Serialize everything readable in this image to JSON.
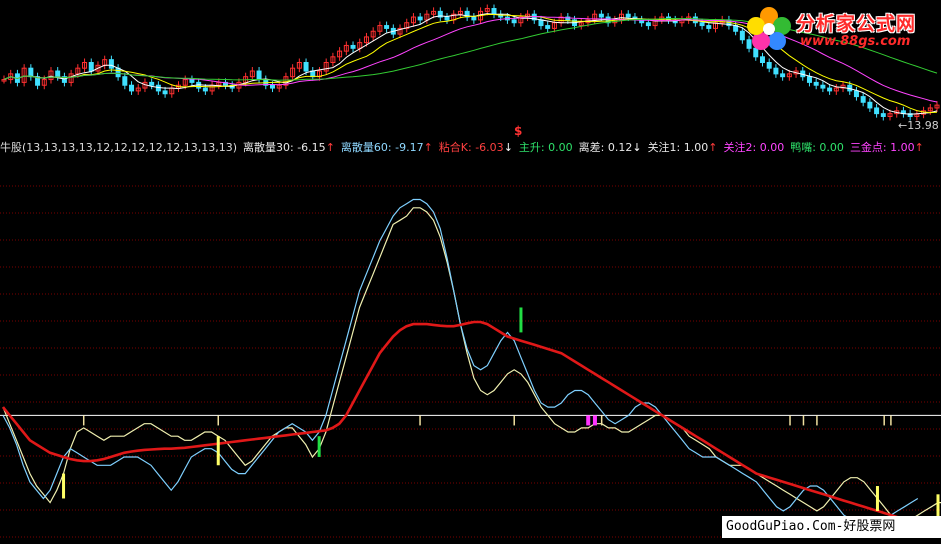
{
  "legend": {
    "items": [
      {
        "label": "牛股(13,13,13,13,12,12,12,12,12,13,13,13)",
        "value": "",
        "arrow": "",
        "color": "#dcdcdc"
      },
      {
        "label": "离散量30:",
        "value": "-6.15",
        "arrow": "↑",
        "color": "#e8e8e8",
        "arrow_color": "#ff3b3b"
      },
      {
        "label": "离散量60:",
        "value": "-9.17",
        "arrow": "↑",
        "color": "#8fd8ff",
        "arrow_color": "#ff3b3b"
      },
      {
        "label": "粘合K:",
        "value": "-6.03",
        "arrow": "↓",
        "color": "#ff4040",
        "arrow_color": "#ffffff"
      },
      {
        "label": "主升:",
        "value": "0.00",
        "arrow": "",
        "color": "#2ee06a",
        "arrow_color": ""
      },
      {
        "label": "离差:",
        "value": "0.12",
        "arrow": "↓",
        "color": "#e8e8e8",
        "arrow_color": "#ffffff"
      },
      {
        "label": "关注1:",
        "value": "1.00",
        "arrow": "↑",
        "color": "#e8e8e8",
        "arrow_color": "#ff3b3b"
      },
      {
        "label": "关注2:",
        "value": "0.00",
        "arrow": "",
        "color": "#ff44ff",
        "arrow_color": ""
      },
      {
        "label": "鸭嘴:",
        "value": "0.00",
        "arrow": "",
        "color": "#2ee06a",
        "arrow_color": ""
      },
      {
        "label": "三金点:",
        "value": "1.00",
        "arrow": "↑",
        "color": "#ff44ff",
        "arrow_color": "#ff3b3b"
      }
    ]
  },
  "price_label": "←13.98",
  "dollar_mark": "$",
  "logo": {
    "text": "分析家公式网",
    "url": "www.88gs.com"
  },
  "watermark": "GoodGuPiao.Com-好股票网",
  "colors": {
    "background": "#000000",
    "grid": "#7a0000",
    "line30": "#f0f0b0",
    "line60": "#7fd0ff",
    "line_k": "#e01818",
    "zero_line": "#ffffff",
    "up_candle": "#ff3030",
    "down_candle": "#40e0ff",
    "signal_yellow": "#ffff66",
    "signal_green": "#22dd44",
    "signal_magenta": "#ff33ff",
    "signal_beige": "#f0e0a0"
  },
  "chart_data": {
    "type": "line",
    "title": "",
    "xlabel": "",
    "ylabel": "",
    "n_bars": 140,
    "series": [
      {
        "name": "离散量30",
        "values": [
          2,
          -2,
          -6,
          -10,
          -14,
          -17,
          -19,
          -21,
          -18,
          -14,
          -8,
          -4,
          -3,
          -4,
          -5,
          -6,
          -5,
          -5,
          -5,
          -4,
          -3,
          -2,
          -2,
          -3,
          -4,
          -5,
          -5,
          -6,
          -6,
          -5,
          -4,
          -4,
          -5,
          -6,
          -8,
          -10,
          -12,
          -11,
          -9,
          -7,
          -5,
          -4,
          -3,
          -3,
          -5,
          -7,
          -10,
          -8,
          -4,
          2,
          8,
          14,
          20,
          26,
          30,
          34,
          38,
          42,
          46,
          47,
          48,
          50,
          50,
          49,
          47,
          43,
          37,
          30,
          22,
          15,
          9,
          6,
          5,
          6,
          8,
          10,
          11,
          10,
          8,
          5,
          2,
          0,
          -2,
          -3,
          -4,
          -4,
          -3,
          -3,
          -2,
          -2,
          -3,
          -3,
          -4,
          -4,
          -3,
          -2,
          -1,
          0,
          0,
          -1,
          -2,
          -3,
          -5,
          -6,
          -7,
          -8,
          -10,
          -11,
          -12,
          -12,
          -12,
          -13,
          -14,
          -15,
          -16,
          -17,
          -18,
          -19,
          -20,
          -21,
          -22,
          -23,
          -22,
          -20,
          -18,
          -16,
          -15,
          -15,
          -16,
          -18,
          -20,
          -22,
          -24,
          -25,
          -26,
          -25,
          -24,
          -23,
          -22,
          -21,
          -21,
          -20
        ]
      },
      {
        "name": "离散量60",
        "values": [
          0,
          -3,
          -7,
          -12,
          -16,
          -18,
          -20,
          -18,
          -14,
          -10,
          -8,
          -9,
          -10,
          -11,
          -12,
          -12,
          -12,
          -11,
          -10,
          -10,
          -10,
          -11,
          -12,
          -14,
          -16,
          -18,
          -16,
          -13,
          -10,
          -9,
          -8,
          -8,
          -9,
          -11,
          -13,
          -14,
          -14,
          -12,
          -10,
          -8,
          -6,
          -4,
          -3,
          -2,
          -3,
          -4,
          -6,
          -4,
          0,
          6,
          12,
          18,
          24,
          30,
          34,
          38,
          42,
          45,
          48,
          50,
          51,
          52,
          52,
          51,
          49,
          45,
          38,
          30,
          22,
          16,
          12,
          11,
          12,
          15,
          18,
          20,
          18,
          14,
          10,
          6,
          3,
          2,
          2,
          3,
          5,
          6,
          6,
          5,
          3,
          1,
          -1,
          -2,
          -1,
          0,
          2,
          3,
          3,
          2,
          0,
          -2,
          -4,
          -6,
          -8,
          -9,
          -10,
          -10,
          -10,
          -11,
          -12,
          -13,
          -14,
          -15,
          -16,
          -18,
          -20,
          -22,
          -23,
          -22,
          -20,
          -18,
          -17,
          -17,
          -18,
          -20,
          -22,
          -24,
          -25,
          -26,
          -27,
          -27,
          -26,
          -25,
          -24,
          -23,
          -22,
          -21,
          -20
        ]
      },
      {
        "name": "粘合K",
        "values": [
          2,
          0,
          -2,
          -4,
          -6,
          -7,
          -8,
          -9,
          -9.5,
          -10,
          -10.5,
          -10.8,
          -11,
          -11,
          -10.8,
          -10.5,
          -10,
          -9.5,
          -9,
          -8.7,
          -8.5,
          -8.3,
          -8.2,
          -8.1,
          -8,
          -8,
          -7.9,
          -7.8,
          -7.6,
          -7.4,
          -7.2,
          -7,
          -6.8,
          -6.6,
          -6.4,
          -6.2,
          -6,
          -5.8,
          -5.6,
          -5.4,
          -5.2,
          -5,
          -4.8,
          -4.6,
          -4.4,
          -4.2,
          -4,
          -3.8,
          -3.6,
          -3,
          -2,
          0,
          3,
          6,
          9,
          12,
          15,
          17,
          19,
          20.5,
          21.5,
          22,
          22,
          22,
          21.8,
          21.6,
          21.5,
          21.5,
          21.8,
          22.2,
          22.5,
          22.5,
          22,
          21,
          20,
          19,
          18.5,
          18,
          17.5,
          17,
          16.5,
          16,
          15.5,
          15,
          14,
          13,
          12,
          11,
          10,
          9,
          8,
          7,
          6,
          5,
          4,
          3,
          2,
          1,
          0,
          -1,
          -2,
          -3,
          -4,
          -5,
          -6,
          -7,
          -8,
          -9,
          -10,
          -11,
          -12,
          -13,
          -14,
          -14.5,
          -15,
          -15.5,
          -16,
          -16.5,
          -17,
          -17.5,
          -18,
          -18.5,
          -19,
          -19.5,
          -20,
          -20.5,
          -21,
          -21.5,
          -22,
          -22.5,
          -23,
          -23.5,
          -24,
          -24.5,
          -25,
          -25.5,
          -26,
          -26.5,
          -27,
          -27.5
        ]
      }
    ],
    "ylim": [
      -30,
      62
    ],
    "baseline": 0,
    "signals": [
      {
        "bar": 9,
        "color": "yellow",
        "from": -14,
        "to": -20
      },
      {
        "bar": 12,
        "color": "beige",
        "from": 0,
        "to": -2
      },
      {
        "bar": 32,
        "color": "beige",
        "from": 0,
        "to": -2
      },
      {
        "bar": 32,
        "color": "yellow",
        "from": -5,
        "to": -12
      },
      {
        "bar": 47,
        "color": "green",
        "from": -5,
        "to": -10
      },
      {
        "bar": 62,
        "color": "beige",
        "from": 0,
        "to": -2
      },
      {
        "bar": 76,
        "color": "beige",
        "from": 0,
        "to": -2
      },
      {
        "bar": 77,
        "color": "green",
        "from": 20,
        "to": 26
      },
      {
        "bar": 87,
        "color": "magenta",
        "from": 0,
        "to": -2
      },
      {
        "bar": 88,
        "color": "magenta",
        "from": 0,
        "to": -2
      },
      {
        "bar": 89,
        "color": "beige",
        "from": 0,
        "to": -2
      },
      {
        "bar": 117,
        "color": "beige",
        "from": 0,
        "to": -2
      },
      {
        "bar": 119,
        "color": "beige",
        "from": 0,
        "to": -2
      },
      {
        "bar": 121,
        "color": "beige",
        "from": 0,
        "to": -2
      },
      {
        "bar": 131,
        "color": "beige",
        "from": 0,
        "to": -2
      },
      {
        "bar": 132,
        "color": "beige",
        "from": 0,
        "to": -2
      },
      {
        "bar": 130,
        "color": "yellow",
        "from": -17,
        "to": -23
      },
      {
        "bar": 139,
        "color": "yellow",
        "from": -19,
        "to": -25
      }
    ],
    "price_panel": {
      "closes": [
        15.2,
        15.4,
        15.1,
        15.6,
        15.3,
        15.0,
        15.2,
        15.5,
        15.3,
        15.1,
        15.4,
        15.6,
        15.8,
        15.5,
        15.7,
        15.9,
        15.6,
        15.3,
        15.0,
        14.8,
        14.9,
        15.1,
        15.0,
        14.8,
        14.7,
        14.9,
        15.0,
        15.2,
        15.1,
        14.9,
        14.8,
        15.0,
        15.1,
        15.0,
        14.9,
        15.1,
        15.3,
        15.5,
        15.2,
        15.0,
        14.9,
        15.0,
        15.3,
        15.6,
        15.8,
        15.5,
        15.3,
        15.5,
        15.8,
        16.0,
        16.2,
        16.4,
        16.3,
        16.5,
        16.7,
        16.9,
        17.1,
        17.0,
        16.8,
        17.0,
        17.2,
        17.4,
        17.3,
        17.5,
        17.6,
        17.4,
        17.3,
        17.5,
        17.6,
        17.4,
        17.3,
        17.6,
        17.7,
        17.5,
        17.4,
        17.3,
        17.2,
        17.4,
        17.5,
        17.3,
        17.1,
        17.0,
        17.2,
        17.4,
        17.3,
        17.1,
        17.2,
        17.3,
        17.5,
        17.4,
        17.2,
        17.3,
        17.5,
        17.4,
        17.3,
        17.2,
        17.1,
        17.3,
        17.4,
        17.3,
        17.2,
        17.3,
        17.4,
        17.2,
        17.1,
        17.0,
        17.2,
        17.3,
        17.1,
        16.9,
        16.6,
        16.3,
        16.0,
        15.8,
        15.6,
        15.4,
        15.3,
        15.4,
        15.5,
        15.3,
        15.1,
        15.0,
        14.9,
        14.8,
        14.9,
        15.0,
        14.8,
        14.6,
        14.4,
        14.2,
        14.0,
        13.9,
        14.0,
        14.1,
        14.0,
        13.9,
        13.98,
        14.1,
        14.2,
        14.3
      ]
    }
  }
}
